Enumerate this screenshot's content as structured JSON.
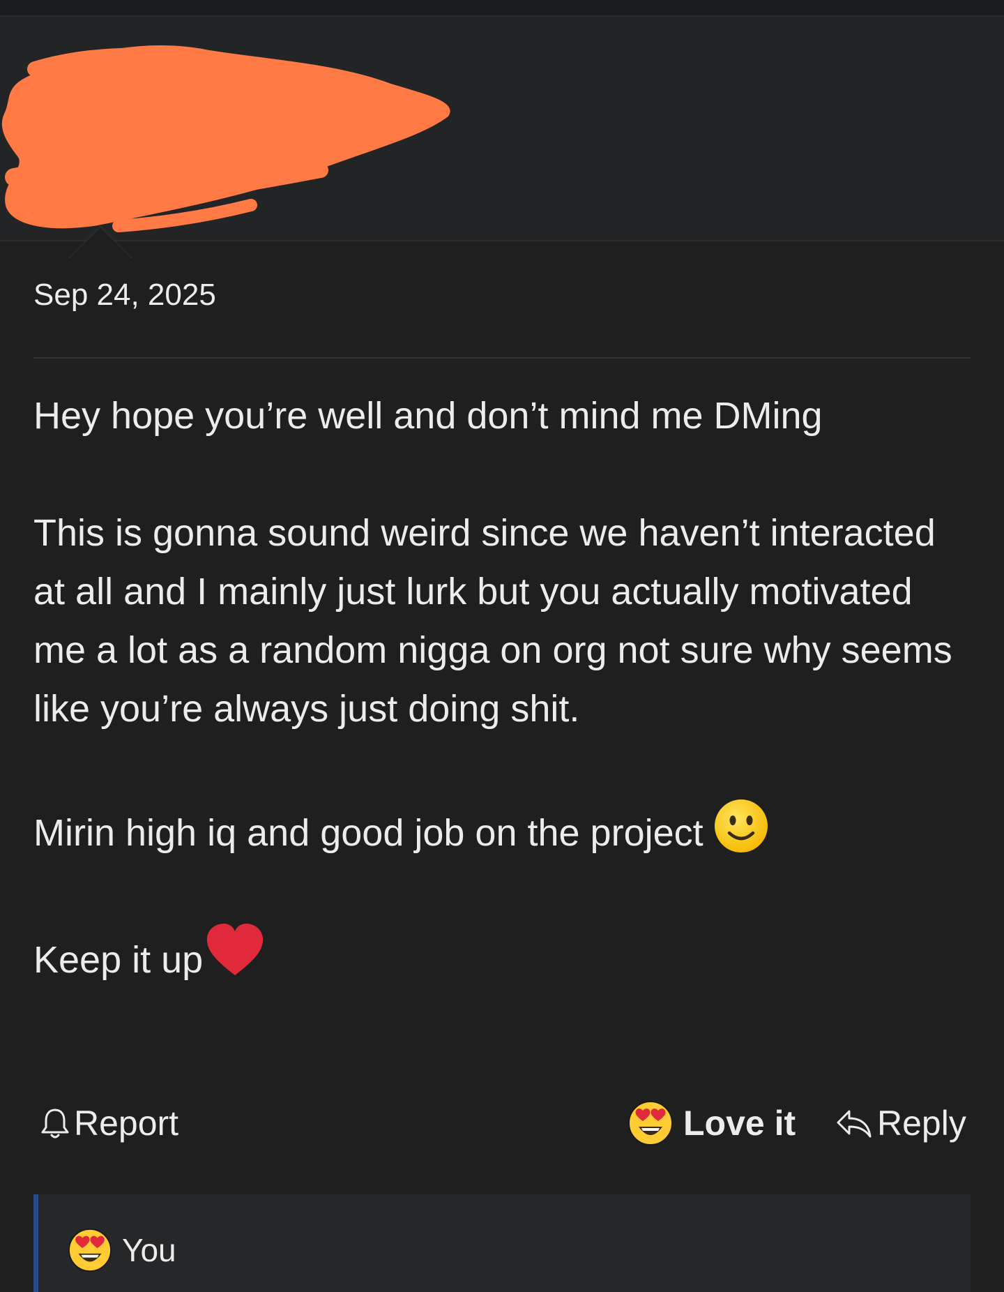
{
  "message": {
    "date": "Sep 24, 2025",
    "paragraphs": [
      "Hey hope you’re well and don’t mind me DMing",
      "This is gonna sound weird since we haven’t interacted at all and I mainly just lurk but you actually motivated me a lot as a random nigga on org not sure why seems like you’re always just doing shit.",
      "Mirin high iq and good job on the project",
      "Keep it up"
    ],
    "paragraph_emojis": [
      "",
      "",
      "slightly-smiling-face",
      "red-heart"
    ]
  },
  "actions": {
    "report_label": "Report",
    "love_label": "Love it",
    "reply_label": "Reply"
  },
  "reactions": {
    "users": [
      "You"
    ],
    "reaction_emoji": "heart-eyes"
  },
  "colors": {
    "background": "#1f1f20",
    "header": "#232425",
    "redaction": "#ff7a45",
    "accent_border": "#2c4a8a",
    "text": "#ececec"
  },
  "icons": {
    "report": "bell-icon",
    "love": "heart-eyes-emoji-icon",
    "reply": "reply-arrow-icon"
  }
}
